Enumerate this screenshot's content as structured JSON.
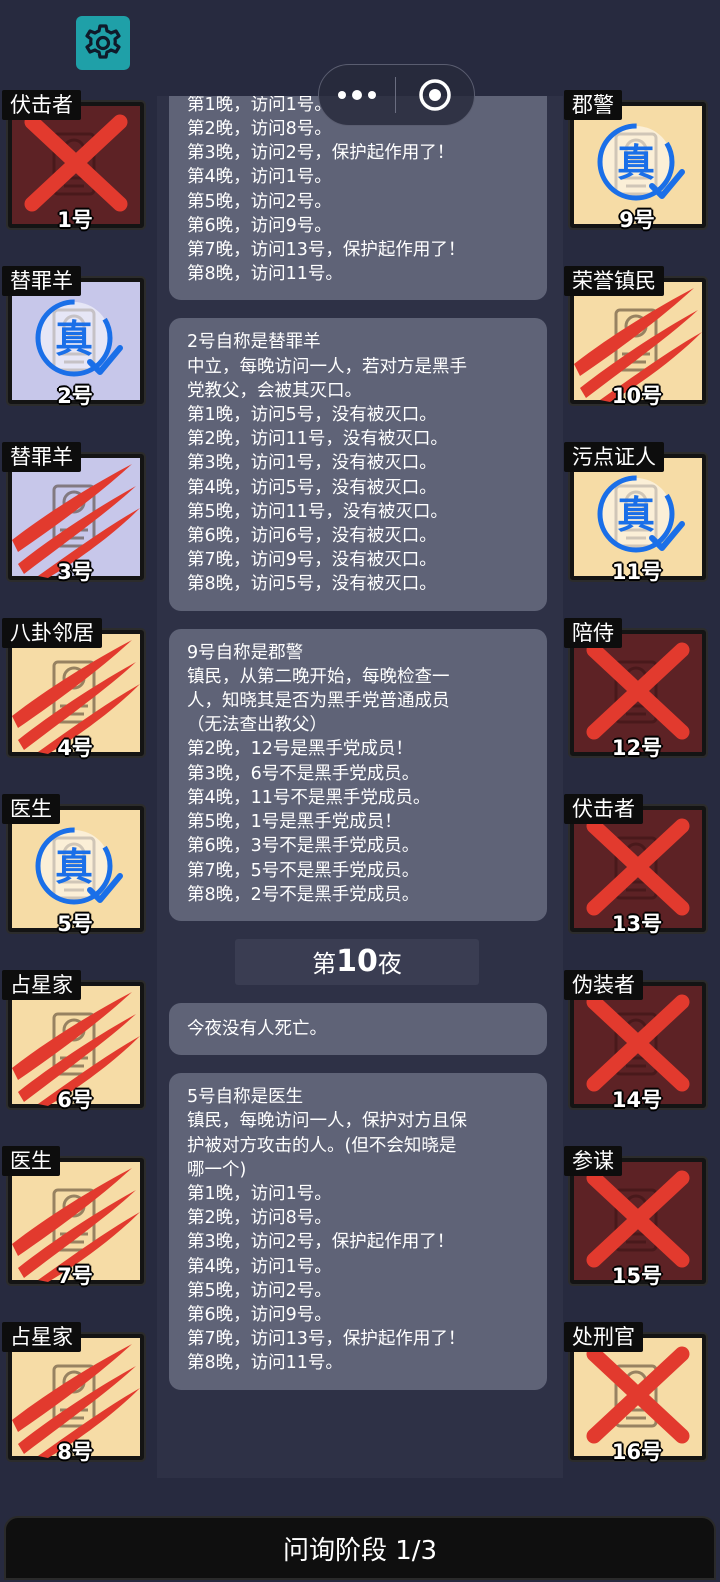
{
  "settings": {
    "icon": "gear-icon"
  },
  "capsule": {
    "menu_icon": "more-dots-icon",
    "close_icon": "record-circle-icon"
  },
  "left_cards": [
    {
      "role": "伏击者",
      "number": "1号",
      "status": "dead-x",
      "bg": "maroon"
    },
    {
      "role": "替罪羊",
      "number": "2号",
      "status": "verified",
      "bg": "lavender"
    },
    {
      "role": "替罪羊",
      "number": "3号",
      "status": "claw",
      "bg": "lavender"
    },
    {
      "role": "八卦邻居",
      "number": "4号",
      "status": "claw",
      "bg": "cream"
    },
    {
      "role": "医生",
      "number": "5号",
      "status": "verified",
      "bg": "cream"
    },
    {
      "role": "占星家",
      "number": "6号",
      "status": "claw",
      "bg": "cream"
    },
    {
      "role": "医生",
      "number": "7号",
      "status": "claw",
      "bg": "cream"
    },
    {
      "role": "占星家",
      "number": "8号",
      "status": "claw",
      "bg": "cream"
    }
  ],
  "right_cards": [
    {
      "role": "郡警",
      "number": "9号",
      "status": "verified",
      "bg": "cream"
    },
    {
      "role": "荣誉镇民",
      "number": "10号",
      "status": "claw",
      "bg": "cream"
    },
    {
      "role": "污点证人",
      "number": "11号",
      "status": "verified",
      "bg": "cream"
    },
    {
      "role": "陪侍",
      "number": "12号",
      "status": "dead-x",
      "bg": "maroon"
    },
    {
      "role": "伏击者",
      "number": "13号",
      "status": "dead-x",
      "bg": "maroon"
    },
    {
      "role": "伪装者",
      "number": "14号",
      "status": "dead-x",
      "bg": "maroon"
    },
    {
      "role": "参谋",
      "number": "15号",
      "status": "dead-x",
      "bg": "maroon"
    },
    {
      "role": "处刑官",
      "number": "16号",
      "status": "dead-x",
      "bg": "cream"
    }
  ],
  "verified_stamp": "真",
  "log": {
    "top_bubble": [
      "5号自称是医生",
      "镇民，每晚访问一人，保护对方且保",
      "护被对方攻击的人。(但不会知晓是",
      "哪一个)",
      "第1晚，访问1号。",
      "第2晚，访问8号。",
      "第3晚，访问2号，保护起作用了！",
      "第4晚，访问1号。",
      "第5晚，访问2号。",
      "第6晚，访问9号。",
      "第7晚，访问13号，保护起作用了！",
      "第8晚，访问11号。"
    ],
    "bubble_2": [
      "2号自称是替罪羊",
      "中立，每晚访问一人，若对方是黑手",
      "党教父，会被其灭口。",
      "第1晚，访问5号，没有被灭口。",
      "第2晚，访问11号，没有被灭口。",
      "第3晚，访问1号，没有被灭口。",
      "第4晚，访问5号，没有被灭口。",
      "第5晚，访问11号，没有被灭口。",
      "第6晚，访问6号，没有被灭口。",
      "第7晚，访问9号，没有被灭口。",
      "第8晚，访问5号，没有被灭口。"
    ],
    "bubble_3": [
      "9号自称是郡警",
      "镇民，从第二晚开始，每晚检查一",
      "人，知晓其是否为黑手党普通成员",
      "（无法查出教父）",
      "第2晚，12号是黑手党成员！",
      "第3晚，6号不是黑手党成员。",
      "第4晚，11号不是黑手党成员。",
      "第5晚，1号是黑手党成员！",
      "第6晚，3号不是黑手党成员。",
      "第7晚，5号不是黑手党成员。",
      "第8晚，2号不是黑手党成员。"
    ],
    "night_prefix": "第",
    "night_number": "10",
    "night_suffix": "夜",
    "no_death": "今夜没有人死亡。",
    "bubble_5": [
      "5号自称是医生",
      "镇民，每晚访问一人，保护对方且保",
      "护被对方攻击的人。(但不会知晓是",
      "哪一个)",
      "第1晚，访问1号。",
      "第2晚，访问8号。",
      "第3晚，访问2号，保护起作用了！",
      "第4晚，访问1号。",
      "第5晚，访问2号。",
      "第6晚，访问9号。",
      "第7晚，访问13号，保护起作用了！",
      "第8晚，访问11号。"
    ]
  },
  "phase": "问询阶段 1/3",
  "colors": {
    "background": "#272a3f",
    "bubble": "#5f6377",
    "cream": "#f6dca6",
    "maroon": "#5d2225",
    "lavender": "#c7c7ea",
    "red_mark": "#e23a2e",
    "verify_blue": "#1a6fe8",
    "settings_teal": "#1fa0a8"
  }
}
